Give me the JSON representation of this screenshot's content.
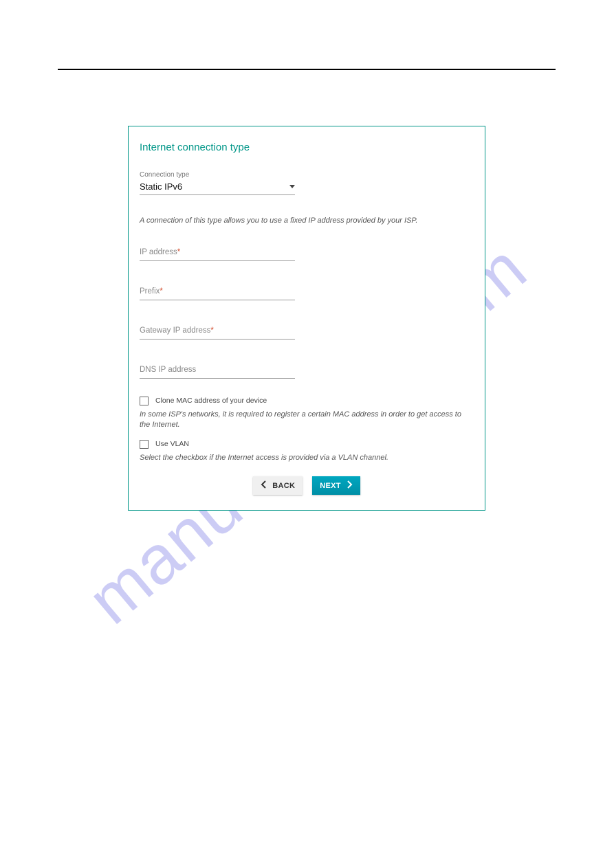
{
  "watermark": "manualshive.com",
  "card": {
    "title": "Internet connection type",
    "connection_type_label": "Connection type",
    "connection_type_value": "Static IPv6",
    "description": "A connection of this type allows you to use a fixed IP address provided by your ISP.",
    "fields": {
      "ip_address": {
        "label": "IP address",
        "required": true
      },
      "prefix": {
        "label": "Prefix",
        "required": true
      },
      "gateway": {
        "label": "Gateway IP address",
        "required": true
      },
      "dns": {
        "label": "DNS IP address",
        "required": false
      }
    },
    "clone_mac": {
      "label": "Clone MAC address of your device",
      "hint": "In some ISP's networks, it is required to register a certain MAC address in order to get access to the Internet."
    },
    "use_vlan": {
      "label": "Use VLAN",
      "hint": "Select the checkbox if the Internet access is provided via a VLAN channel."
    },
    "buttons": {
      "back": "BACK",
      "next": "NEXT"
    }
  }
}
